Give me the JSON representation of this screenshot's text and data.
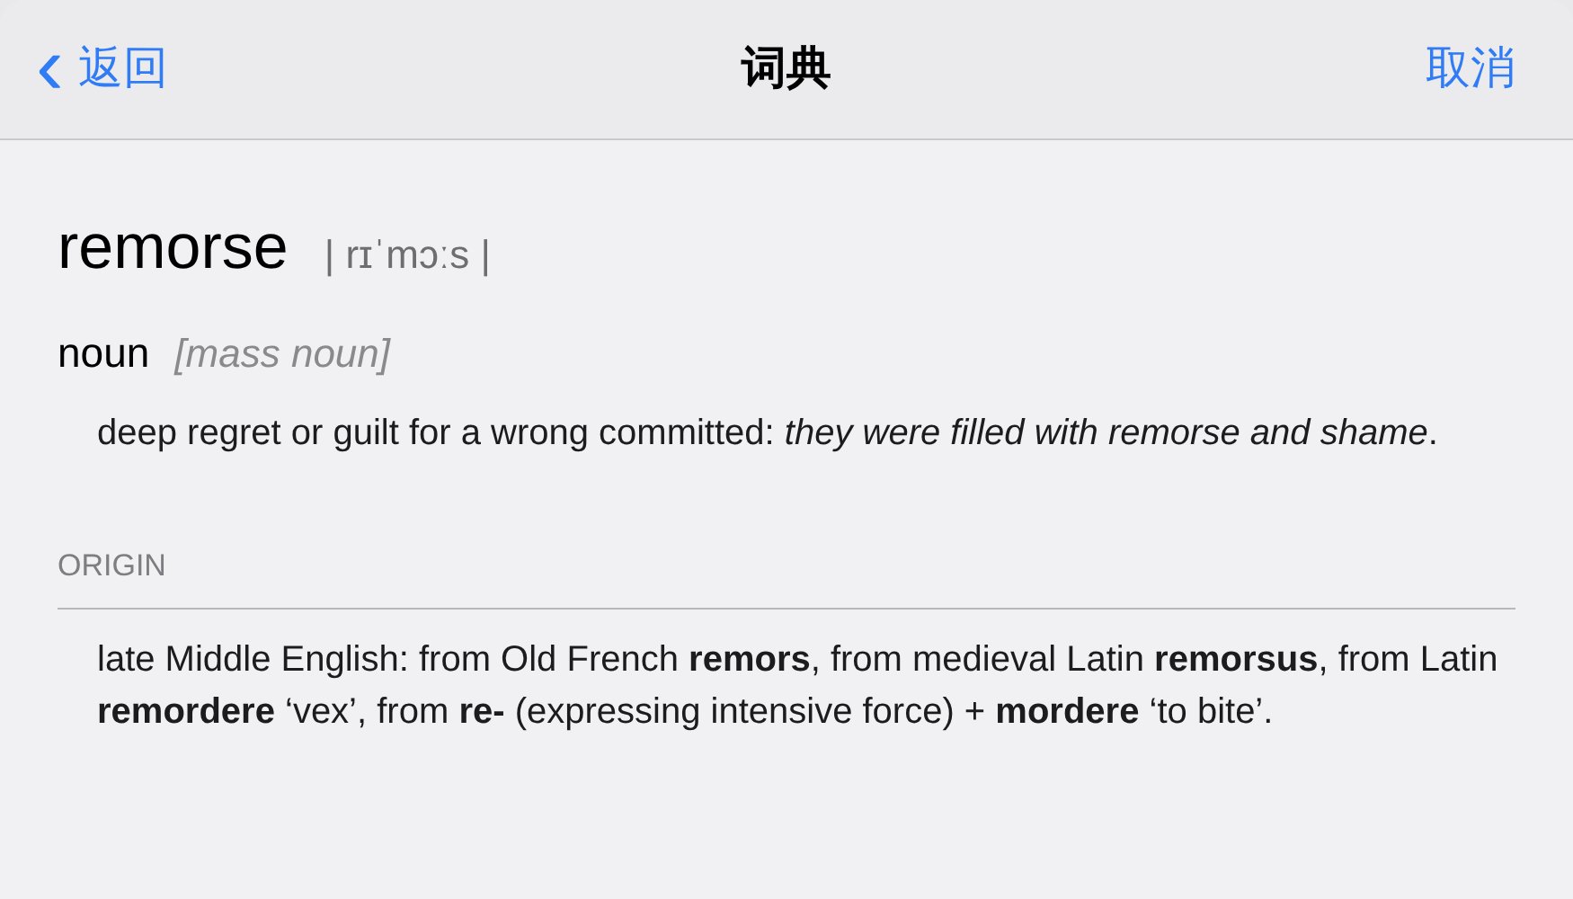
{
  "nav_bar": {
    "back": {
      "icon": "‹",
      "label": "返回"
    },
    "title": "词典",
    "cancel": "取消"
  },
  "entry": {
    "headword": "remorse",
    "pronunciation": "| rɪˈmɔːs |",
    "part_of_speech": "noun",
    "grammar": "[mass noun]",
    "definition": "deep regret or guilt for a wrong committed: *they were filled with remorse and shame*."
  },
  "origin": {
    "heading": "ORIGIN",
    "text": "late Middle English: from Old French **remors**, from medieval Latin **remorsus**, from Latin **remordere** ‘vex’, from **re-** (expressing intensive force) + **mordere** ‘to bite’."
  }
}
